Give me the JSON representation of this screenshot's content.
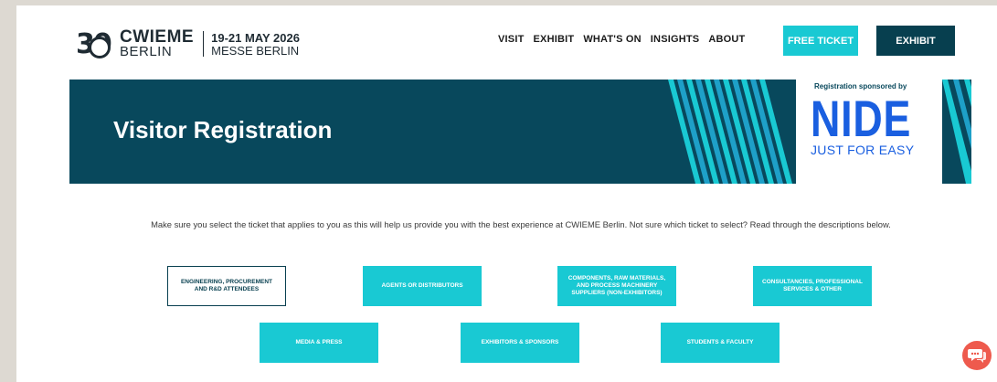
{
  "header": {
    "logo": {
      "number": "30",
      "name": "CWIEME",
      "city": "BERLIN",
      "date": "19-21 MAY 2026",
      "venue": "MESSE BERLIN"
    },
    "nav": [
      "VISIT",
      "EXHIBIT",
      "WHAT'S ON",
      "INSIGHTS",
      "ABOUT"
    ],
    "free_ticket_label": "FREE TICKET",
    "exhibit_label": "EXHIBIT"
  },
  "banner": {
    "title": "Visitor Registration",
    "sponsor_label": "Registration sponsored by",
    "sponsor_logo": "NIDE",
    "sponsor_tagline": "JUST FOR EASY"
  },
  "intro": "Make sure you select the ticket that applies to you as this will help us provide you with the best experience at CWIEME Berlin. Not sure which ticket to select? Read through the descriptions below.",
  "tickets": [
    "ENGINEERING, PROCUREMENT AND R&D ATTENDEES",
    "AGENTS OR DISTRIBUTORS",
    "COMPONENTS, RAW MATERIALS, AND PROCESS MACHINERY SUPPLIERS (NON-EXHIBITORS)",
    "CONSULTANCIES, PROFESSIONAL SERVICES & OTHER",
    "MEDIA & PRESS",
    "EXHIBITORS & SPONSORS",
    "STUDENTS & FACULTY"
  ],
  "colors": {
    "teal": "#19c9d3",
    "navy": "#073f4f",
    "banner": "#08485c",
    "sponsor_blue": "#1a5fe0",
    "chat": "#ee5a4d"
  },
  "icons": {
    "chat": "chat-bubble-icon"
  }
}
